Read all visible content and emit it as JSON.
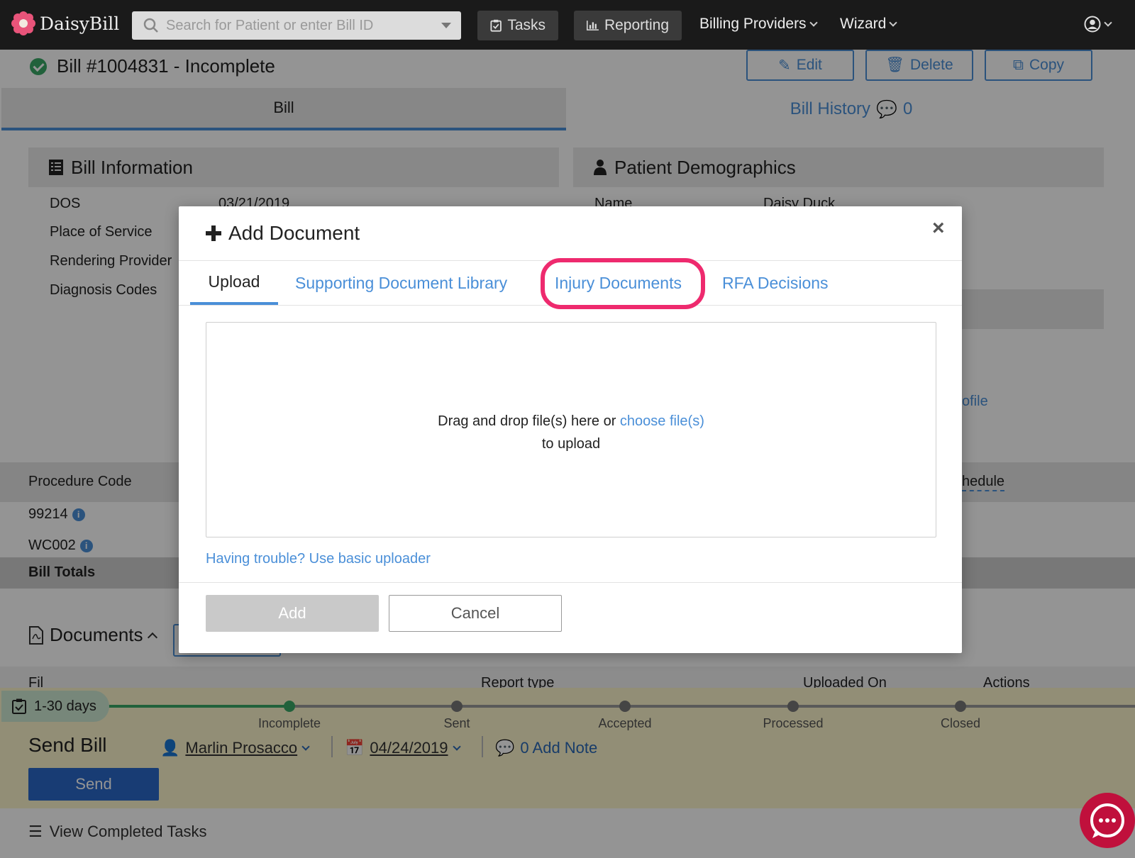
{
  "app": {
    "brand": "DaisyBill"
  },
  "topnav": {
    "search_placeholder": "Search for Patient or enter Bill ID",
    "tasks": "Tasks",
    "reporting": "Reporting",
    "billing_providers": "Billing Providers",
    "wizard": "Wizard"
  },
  "bill": {
    "title": "Bill #1004831 - Incomplete",
    "edit": "Edit",
    "delete": "Delete",
    "copy": "Copy",
    "tab_bill": "Bill",
    "tab_history": "Bill History",
    "history_count": "0"
  },
  "bill_info": {
    "heading": "Bill Information",
    "rows": [
      {
        "label": "DOS",
        "value": "03/21/2019"
      },
      {
        "label": "Place of Service",
        "value": ""
      },
      {
        "label": "Rendering Provider",
        "value": ""
      },
      {
        "label": "Diagnosis Codes",
        "value": ""
      }
    ]
  },
  "patient": {
    "heading": "Patient Demographics",
    "name_label": "Name",
    "name_value": "Daisy Duck",
    "profile_partial": "ofile"
  },
  "procedures": {
    "header": "Procedure Code",
    "schedule_partial": "hedule",
    "codes": [
      "99214",
      "WC002"
    ],
    "totals": "Bill Totals"
  },
  "documents": {
    "heading": "Documents",
    "col_file_partial": "Fil",
    "col_report_type": "Report type",
    "col_uploaded_on": "Uploaded On",
    "col_actions": "Actions"
  },
  "workflow": {
    "days": "1-30 days",
    "steps": [
      "Incomplete",
      "Sent",
      "Accepted",
      "Processed",
      "Closed"
    ],
    "send_title": "Send Bill",
    "assignee": "Marlin Prosacco",
    "date": "04/24/2019",
    "note": "0 Add Note",
    "send": "Send",
    "completed": "View Completed Tasks"
  },
  "modal": {
    "title": "Add Document",
    "close": "×",
    "tabs": [
      "Upload",
      "Supporting Document Library",
      "Injury Documents",
      "RFA Decisions"
    ],
    "active_tab": "Upload",
    "highlighted_tab": "Injury Documents",
    "drop_text": "Drag and drop file(s) here or",
    "choose_link": "choose file(s)",
    "drop_text2": "to upload",
    "trouble": "Having trouble? Use basic uploader",
    "add": "Add",
    "cancel": "Cancel"
  },
  "colors": {
    "accent": "#4a8fd8",
    "highlight": "#ee2a6e",
    "success": "#3aa867",
    "nav_bg": "#1a1a1a",
    "chat": "#c0103c"
  },
  "icons": [
    "daisy-logo-icon",
    "search-icon",
    "tasks-icon",
    "reporting-icon",
    "user-icon",
    "check-icon",
    "edit-icon",
    "trash-icon",
    "copy-icon",
    "comment-icon",
    "bill-info-icon",
    "patient-icon",
    "info-icon",
    "pdf-icon",
    "calendar-icon",
    "list-icon",
    "plus-icon",
    "close-icon",
    "chat-icon"
  ]
}
